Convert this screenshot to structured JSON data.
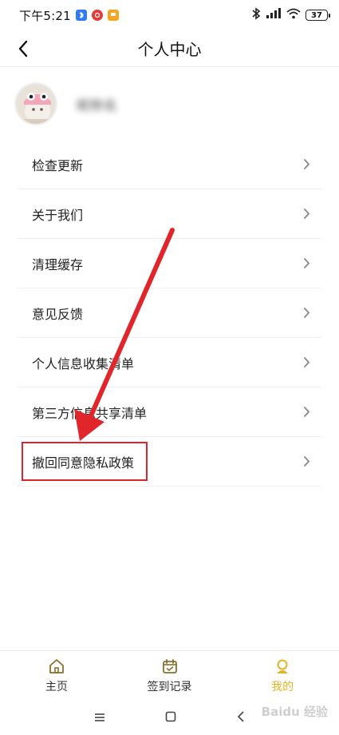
{
  "status": {
    "time": "下午5:21",
    "battery": "37"
  },
  "header": {
    "title": "个人中心"
  },
  "profile": {
    "username": "昵称名"
  },
  "menu": {
    "items": [
      {
        "label": "检查更新"
      },
      {
        "label": "关于我们"
      },
      {
        "label": "清理缓存"
      },
      {
        "label": "意见反馈"
      },
      {
        "label": "个人信息收集清单"
      },
      {
        "label": "第三方信息共享清单"
      },
      {
        "label": "撤回同意隐私政策"
      }
    ]
  },
  "tabs": [
    {
      "label": "主页",
      "icon": "home-icon"
    },
    {
      "label": "签到记录",
      "icon": "calendar-check-icon"
    },
    {
      "label": "我的",
      "icon": "profile-icon",
      "active": true
    }
  ],
  "watermark": "Baidu 经验",
  "colors": {
    "accent": "#e6b422",
    "annotation_red": "#e0262b"
  }
}
